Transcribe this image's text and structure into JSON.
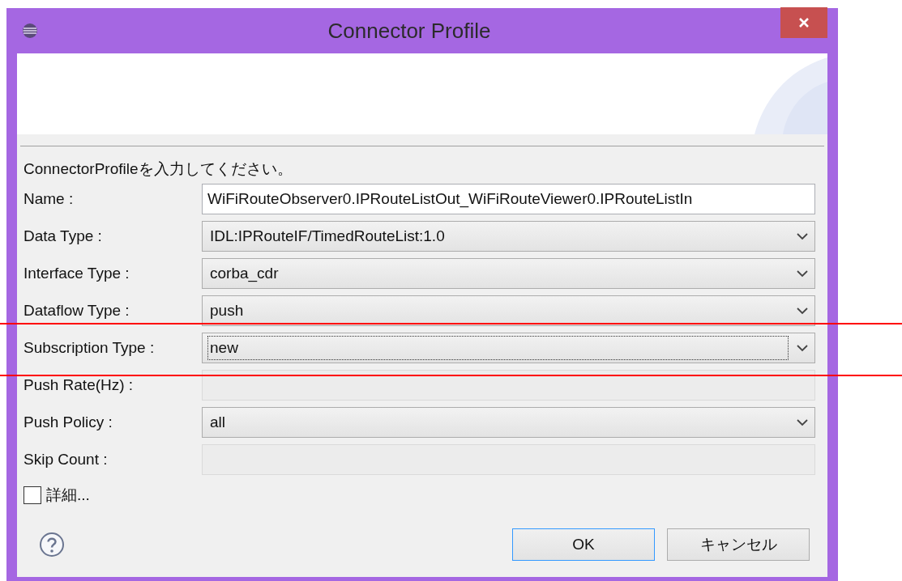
{
  "window": {
    "title": "Connector Profile"
  },
  "instruction": "ConnectorProfileを入力してください。",
  "fields": [
    {
      "label": "Name :",
      "kind": "text",
      "value": "WiFiRouteObserver0.IPRouteListOut_WiFiRouteViewer0.IPRouteListIn",
      "disabled": false,
      "focused": false
    },
    {
      "label": "Data Type :",
      "kind": "select",
      "value": "IDL:IPRouteIF/TimedRouteList:1.0",
      "disabled": false,
      "focused": false
    },
    {
      "label": "Interface Type :",
      "kind": "select",
      "value": "corba_cdr",
      "disabled": false,
      "focused": false
    },
    {
      "label": "Dataflow Type :",
      "kind": "select",
      "value": "push",
      "disabled": false,
      "focused": false
    },
    {
      "label": "Subscription Type :",
      "kind": "select",
      "value": "new",
      "disabled": false,
      "focused": true
    },
    {
      "label": "Push Rate(Hz) :",
      "kind": "text",
      "disabled": true,
      "focused": false
    },
    {
      "label": "Push Policy :",
      "kind": "select",
      "value": "all",
      "disabled": false,
      "focused": false
    },
    {
      "label": "Skip Count :",
      "kind": "text",
      "disabled": true,
      "focused": false
    }
  ],
  "details_checkbox": {
    "label": "詳細...",
    "checked": false
  },
  "buttons": [
    {
      "label": "OK",
      "default": true
    },
    {
      "label": "キャンセル",
      "default": false
    }
  ]
}
